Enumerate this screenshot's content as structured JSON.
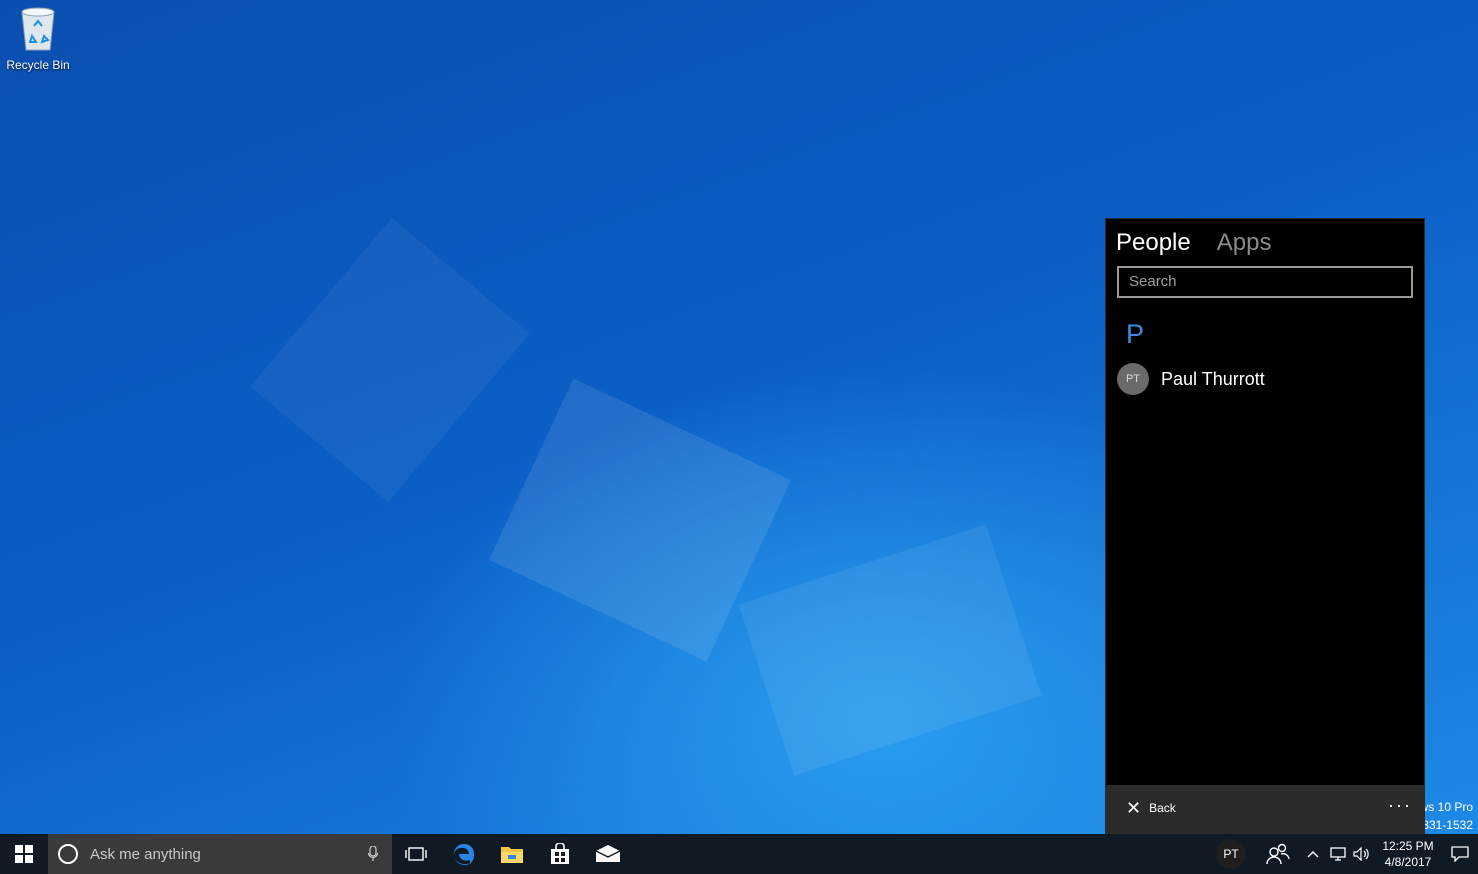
{
  "desktop": {
    "recycle_bin_label": "Recycle Bin",
    "watermark_line1": "ws 10 Pro",
    "watermark_line2": "331-1532"
  },
  "people_flyout": {
    "tabs": [
      {
        "label": "People",
        "active": true
      },
      {
        "label": "Apps",
        "active": false
      }
    ],
    "search": {
      "placeholder": "Search",
      "value": ""
    },
    "group_letter": "P",
    "contacts": [
      {
        "initials": "PT",
        "name": "Paul Thurrott"
      }
    ],
    "footer": {
      "back_label": "Back",
      "more_label": "···"
    }
  },
  "taskbar": {
    "search_placeholder": "Ask me anything",
    "pinned_apps": [
      "task-view",
      "edge",
      "file-explorer",
      "store",
      "mail"
    ],
    "people_avatar_initials": "PT",
    "clock": {
      "time": "12:25 PM",
      "date": "4/8/2017"
    }
  },
  "colors": {
    "flyout_bg": "#000000",
    "accent": "#3c8be0",
    "taskbar_bg": "#101a24",
    "search_bar_bg": "#3a3a3a"
  }
}
